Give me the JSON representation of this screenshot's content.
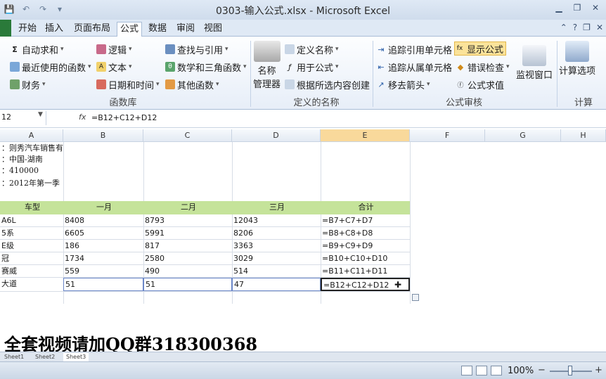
{
  "window": {
    "title": "0303-输入公式.xlsx - Microsoft Excel"
  },
  "qat": {
    "save": "💾",
    "undo": "↶",
    "redo": "↷",
    "more": "▾"
  },
  "ribbon_tabs": [
    "开始",
    "插入",
    "页面布局",
    "公式",
    "数据",
    "审阅",
    "视图"
  ],
  "active_tab": "公式",
  "ribbon": {
    "library": {
      "autosum": "自动求和",
      "recent": "最近使用的函数",
      "finance": "财务",
      "logic": "逻辑",
      "text": "文本",
      "datetime": "日期和时间",
      "lookup": "查找与引用",
      "math": "数学和三角函数",
      "other": "其他函数",
      "label": "函数库"
    },
    "names": {
      "manager_line1": "名称",
      "manager_line2": "管理器",
      "define": "定义名称",
      "use": "用于公式",
      "create": "根据所选内容创建",
      "label": "定义的名称"
    },
    "audit": {
      "trace_precedents": "追踪引用单元格",
      "trace_dependents": "追踪从属单元格",
      "remove_arrows": "移去箭头",
      "show_formulas": "显示公式",
      "error_check": "错误检查",
      "evaluate": "公式求值",
      "watch": "监视窗口",
      "label": "公式审核"
    },
    "calc": {
      "options": "计算选项",
      "label": "计算"
    }
  },
  "formula_bar": {
    "name_box": "12",
    "fx": "fx",
    "formula": "=B12+C12+D12"
  },
  "grid": {
    "columns": [
      "A",
      "B",
      "C",
      "D",
      "E",
      "F",
      "G",
      "H"
    ],
    "selected_column": "E",
    "info_rows": [
      "：则秀汽车销售有",
      "：中国-湖南",
      "：410000",
      "：2012年第一季"
    ],
    "header": [
      "车型",
      "一月",
      "二月",
      "三月",
      "合计"
    ],
    "rows": [
      [
        "A6L",
        "8408",
        "8793",
        "12043",
        "=B7+C7+D7"
      ],
      [
        "5系",
        "6605",
        "5991",
        "8206",
        "=B8+C8+D8"
      ],
      [
        "E级",
        "186",
        "817",
        "3363",
        "=B9+C9+D9"
      ],
      [
        "冠",
        "1734",
        "2580",
        "3029",
        "=B10+C10+D10"
      ],
      [
        "赛威",
        "559",
        "490",
        "514",
        "=B11+C11+D11"
      ],
      [
        "大道",
        "51",
        "51",
        "47",
        "=B12+C12+D12"
      ]
    ]
  },
  "watermark": "全套视频请加QQ群318300368",
  "sheets": [
    "Sheet1",
    "Sheet2",
    "Sheet3"
  ],
  "active_sheet": "Sheet3",
  "status": {
    "zoom": "100%",
    "minus": "−",
    "plus": "+"
  },
  "colors": {
    "header_fill": "#c5e39a",
    "highlight": "#fbe39a",
    "ribbon_bg": "#dfe9f5"
  }
}
